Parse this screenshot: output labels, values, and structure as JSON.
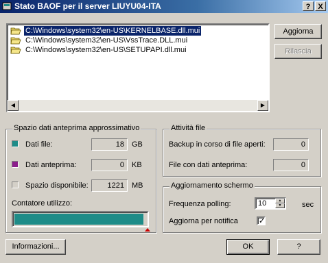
{
  "window": {
    "title": "Stato BAOF per il server LIUYU04-ITA",
    "title_buttons": [
      "?",
      "X"
    ]
  },
  "file_list": {
    "items": [
      {
        "path": "C:\\Windows\\system32\\en-US\\KERNELBASE.dll.mui",
        "selected": true
      },
      {
        "path": "C:\\Windows\\system32\\en-US\\VssTrace.DLL.mui",
        "selected": false
      },
      {
        "path": "C:\\Windows\\system32\\en-US\\SETUPAPI.dll.mui",
        "selected": false
      }
    ]
  },
  "buttons": {
    "refresh": "Aggiorna",
    "release": "Rilascia",
    "info": "Informazioni...",
    "ok": "OK",
    "help": "?"
  },
  "preview_space": {
    "title": "Spazio dati anteprima approssimativo",
    "rows": [
      {
        "label": "Dati file:",
        "value": "18",
        "unit": "GB",
        "color": "#1e8c88"
      },
      {
        "label": "Dati anteprima:",
        "value": "0",
        "unit": "KB",
        "color": "#8c1e8c"
      },
      {
        "label": "Spazio disponibile:",
        "value": "1221",
        "unit": "MB",
        "color": "#d4d0c8"
      }
    ],
    "usage_label": "Contatore utilizzo:",
    "usage_fraction": 0.98
  },
  "file_activity": {
    "title": "Attività file",
    "rows": [
      {
        "label": "Backup in corso di file aperti:",
        "value": "0"
      },
      {
        "label": "File con dati anteprima:",
        "value": "0"
      }
    ]
  },
  "screen_update": {
    "title": "Aggiornamento schermo",
    "polling_label": "Frequenza polling:",
    "polling_value": "10",
    "polling_unit": "sec",
    "notify_label": "Aggiorna per notifica",
    "notify_checked": true
  }
}
